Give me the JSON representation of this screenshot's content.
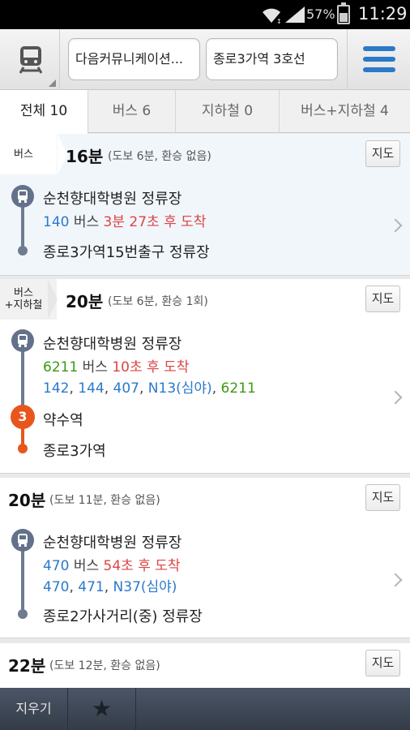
{
  "status": {
    "battery": "57%",
    "battery_level": 0.57,
    "time": "11:29"
  },
  "header": {
    "start": "다음커뮤니케이션...",
    "end": "종로3가역 3호선"
  },
  "tabs": [
    {
      "label": "전체 10",
      "active": true
    },
    {
      "label": "버스 6",
      "active": false
    },
    {
      "label": "지하철 0",
      "active": false
    },
    {
      "label": "버스+지하철 4",
      "active": false
    }
  ],
  "routes": [
    {
      "tag": "버스",
      "duration": "16분",
      "meta": "(도보 6분, 환승 없음)",
      "map": "지도",
      "start_stop": "순천향대학병원 정류장",
      "bus_no": "140",
      "bus_word": " 버스 ",
      "arrival": "3분 27초 후 도착",
      "end_stop": "종로3가역15번출구 정류장"
    },
    {
      "tag": "버스\n+지하철",
      "tag_line1": "버스",
      "tag_line2": "+지하철",
      "duration": "20분",
      "meta": "(도보 6분, 환승 1회)",
      "map": "지도",
      "start_stop": "순천향대학병원 정류장",
      "bus_no": "6211",
      "bus_word": " 버스 ",
      "arrival": "10초 후 도착",
      "alt_buses": [
        "142",
        "144",
        "407",
        "N13(심야)",
        "6211"
      ],
      "subway_line": "3",
      "transfer_station": "약수역",
      "end_stop": "종로3가역"
    },
    {
      "duration": "20분",
      "meta": "(도보 11분, 환승 없음)",
      "map": "지도",
      "start_stop": "순천향대학병원 정류장",
      "bus_no": "470",
      "bus_word": " 버스 ",
      "arrival": "54초 후 도착",
      "alt_buses": [
        "470",
        "471",
        "N37(심야)"
      ],
      "end_stop": "종로2가사거리(중) 정류장"
    },
    {
      "duration": "22분",
      "meta": "(도보 12분, 환승 없음)",
      "map": "지도"
    }
  ],
  "bottom": {
    "clear": "지우기",
    "favorite_icon": "★"
  },
  "colors": {
    "blue": "#2b79c9",
    "red": "#dd4444",
    "green": "#3a9a12",
    "subway_line3": "#e8561e"
  }
}
